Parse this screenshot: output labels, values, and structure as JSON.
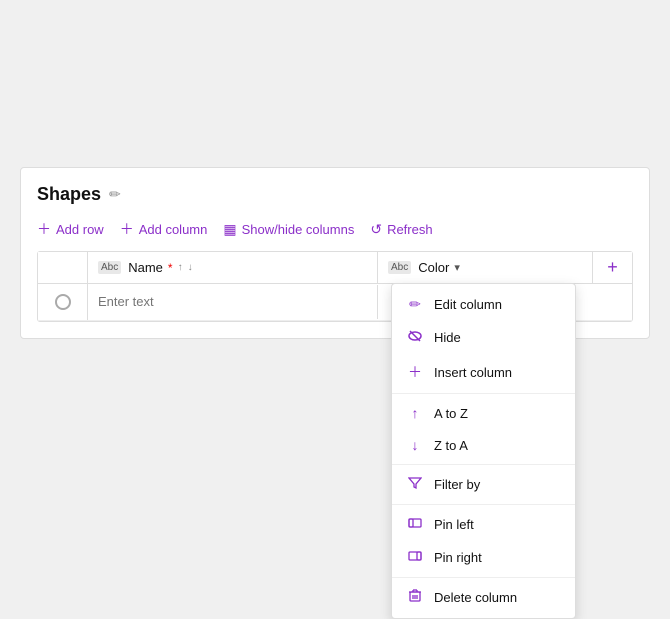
{
  "panel": {
    "title": "Shapes",
    "edit_icon": "✏"
  },
  "toolbar": {
    "add_row": "Add row",
    "add_column": "Add column",
    "show_hide": "Show/hide columns",
    "refresh": "Refresh"
  },
  "grid": {
    "col_name": "Name",
    "col_color": "Color",
    "col_add": "+",
    "placeholder": "Enter text"
  },
  "menu": {
    "items": [
      {
        "icon": "✏",
        "label": "Edit column"
      },
      {
        "icon": "👁",
        "label": "Hide"
      },
      {
        "icon": "+",
        "label": "Insert column"
      },
      {
        "icon": "↑",
        "label": "A to Z"
      },
      {
        "icon": "↓",
        "label": "Z to A"
      },
      {
        "icon": "⛉",
        "label": "Filter by"
      },
      {
        "icon": "⬛",
        "label": "Pin left"
      },
      {
        "icon": "⬛",
        "label": "Pin right"
      },
      {
        "icon": "🗑",
        "label": "Delete column"
      }
    ]
  }
}
